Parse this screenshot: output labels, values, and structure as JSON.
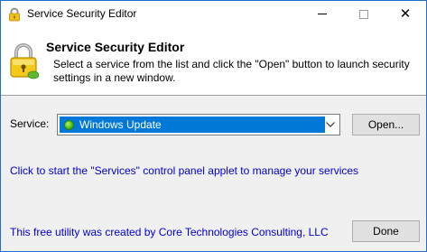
{
  "window": {
    "title": "Service Security Editor",
    "controls": {
      "minimize": "minimize",
      "maximize": "maximize",
      "close": "✕"
    }
  },
  "header": {
    "title": "Service Security Editor",
    "description": "Select a service from the list and click the \"Open\" button to launch security settings in a new window."
  },
  "service": {
    "label": "Service:",
    "selected": "Windows Update",
    "status_icon": "running-status-icon"
  },
  "buttons": {
    "open": "Open...",
    "done": "Done"
  },
  "links": {
    "services_applet": "Click to start the \"Services\" control panel applet to manage your services",
    "credit": "This free utility was created by Core Technologies Consulting, LLC"
  },
  "colors": {
    "accent": "#0078d7",
    "link": "#0000cc",
    "border": "#1f6fcf"
  }
}
